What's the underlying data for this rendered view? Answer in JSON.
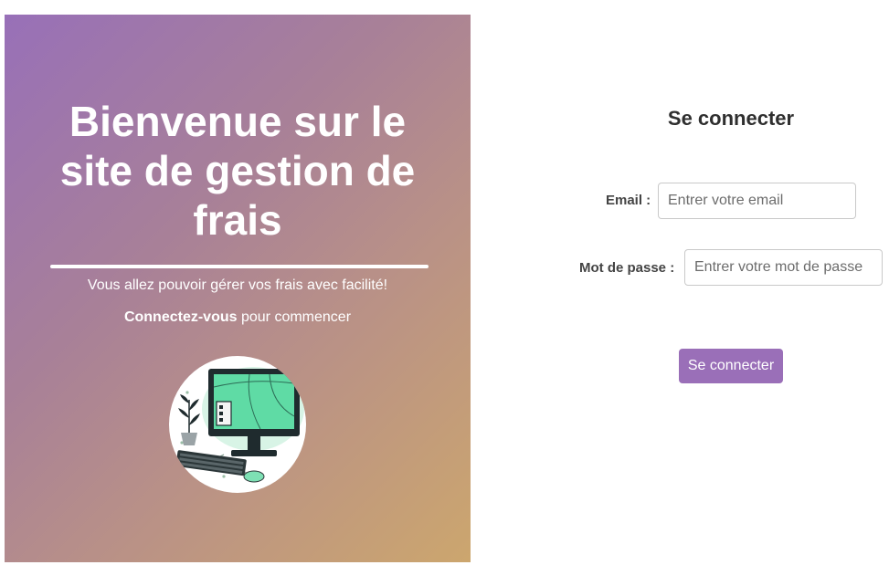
{
  "hero": {
    "title": "Bienvenue sur le site de gestion de frais",
    "subtitle": "Vous allez pouvoir gérer vos frais avec facilité!",
    "cta_strong": "Connectez-vous",
    "cta_rest": " pour commencer",
    "illustration_icon": "computer-desk-illustration",
    "gradient_start": "#9870b8",
    "gradient_end": "#cca66e"
  },
  "login": {
    "title": "Se connecter",
    "email_label": "Email :",
    "email_placeholder": "Entrer votre email",
    "email_value": "",
    "password_label": "Mot de passe :",
    "password_placeholder": "Entrer votre mot de passe",
    "password_value": "",
    "submit_label": "Se connecter",
    "accent_color": "#9a6fb8"
  }
}
